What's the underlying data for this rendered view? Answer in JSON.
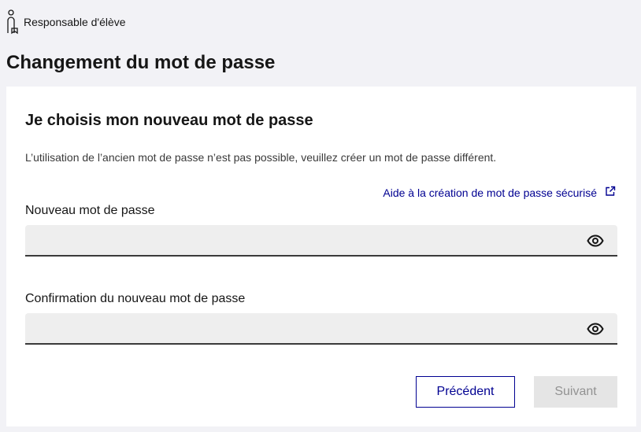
{
  "header": {
    "role_label": "Responsable d'élève",
    "page_title": "Changement du mot de passe"
  },
  "card": {
    "title": "Je choisis mon nouveau mot de passe",
    "description": "L’utilisation de l’ancien mot de passe n’est pas possible, veuillez créer un mot de passe différent.",
    "help_link": "Aide à la création de mot de passe sécurisé",
    "fields": {
      "new_password": {
        "label": "Nouveau mot de passe",
        "value": ""
      },
      "confirm_password": {
        "label": "Confirmation du nouveau mot de passe",
        "value": ""
      }
    },
    "buttons": {
      "previous": "Précédent",
      "next": "Suivant"
    }
  },
  "icons": {
    "role": "person-badge-icon",
    "external": "external-link-icon",
    "reveal": "eye-icon"
  },
  "colors": {
    "primary": "#000091",
    "background": "#f2f2f6",
    "input_bg": "#eeeeee",
    "disabled_bg": "#e5e5e5",
    "disabled_text": "#929292"
  }
}
